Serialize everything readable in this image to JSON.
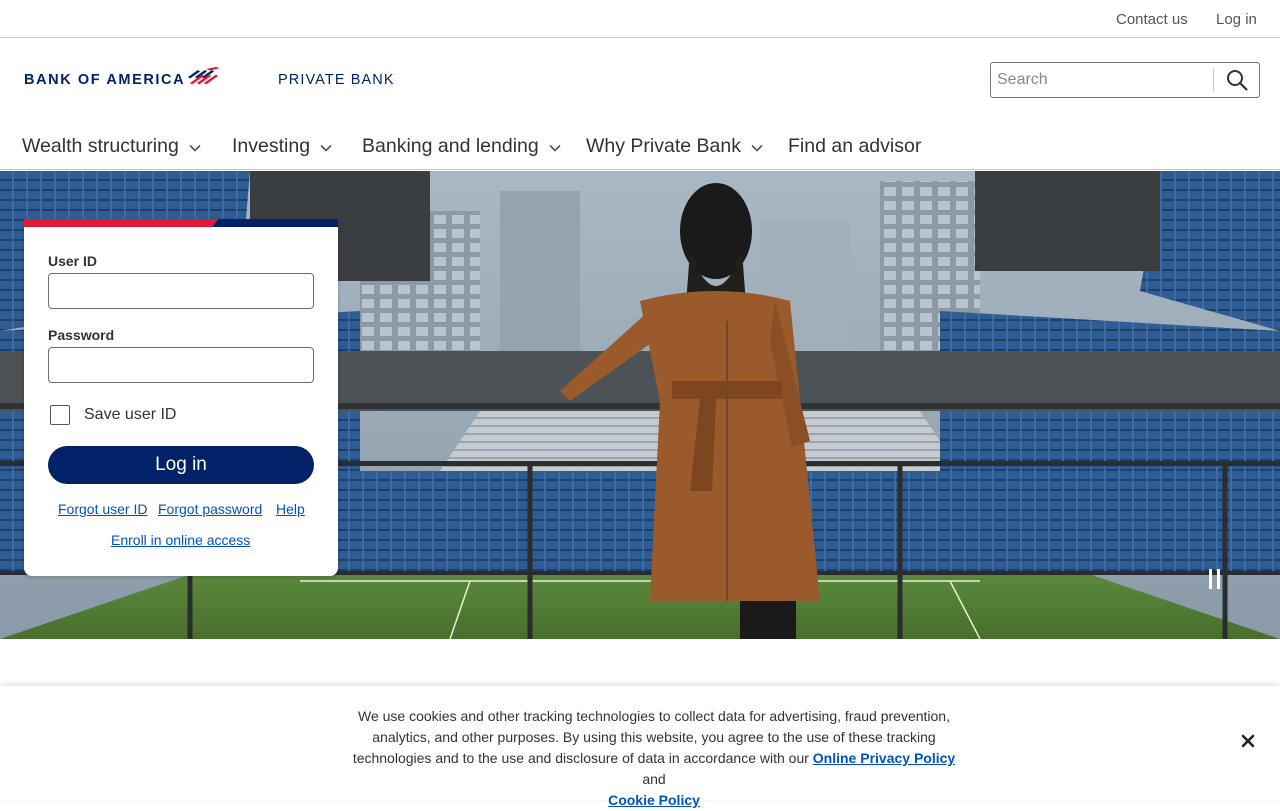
{
  "utility_nav": {
    "contact": "Contact us",
    "login": "Log in"
  },
  "brand": {
    "logo_text": "BANK OF AMERICA",
    "logo_icon": "flag-logo-icon",
    "sub_brand": "PRIVATE BANK"
  },
  "search": {
    "placeholder": "Search",
    "icon": "search-icon"
  },
  "main_nav": {
    "items": [
      {
        "label": "Wealth structuring",
        "has_dropdown": true
      },
      {
        "label": "Investing",
        "has_dropdown": true
      },
      {
        "label": "Banking and lending",
        "has_dropdown": true
      },
      {
        "label": "Why Private Bank",
        "has_dropdown": true
      },
      {
        "label": "Find an advisor",
        "has_dropdown": false
      }
    ]
  },
  "login": {
    "user_label": "User ID",
    "password_label": "Password",
    "save_label": "Save user ID",
    "button_label": "Log in",
    "forgot_id": "Forgot user ID",
    "forgot_password": "Forgot password",
    "help": "Help",
    "enroll": "Enroll in online access"
  },
  "hero": {
    "pause_icon": "pause-icon"
  },
  "cookie_banner": {
    "text_part1": "We use cookies and other tracking technologies to collect data for advertising, fraud prevention, analytics, and other purposes. By using this website, you agree to the use of these tracking technologies and to the use and disclosure of data in accordance with our ",
    "privacy_link": "Online Privacy Policy",
    "text_part2": " and ",
    "cookie_link": "Cookie Policy",
    "close_icon": "close-icon"
  },
  "colors": {
    "brand_navy": "#012169",
    "brand_red": "#e31837",
    "link_blue": "#0052c2"
  }
}
